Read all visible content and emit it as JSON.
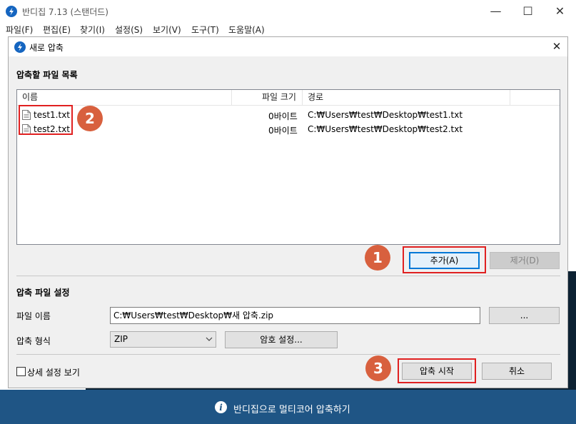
{
  "app": {
    "title": "반디집 7.13 (스탠더드)",
    "window_controls": [
      "—",
      "☐",
      "✕"
    ]
  },
  "menu": [
    "파일(F)",
    "편집(E)",
    "찾기(I)",
    "설정(S)",
    "보기(V)",
    "도구(T)",
    "도움말(A)"
  ],
  "dialog": {
    "title": "새로 압축",
    "close": "✕",
    "file_list_section": "압축할 파일 목록",
    "columns": {
      "name": "이름",
      "size": "파일 크기",
      "path": "경로"
    },
    "files": [
      {
        "name": "test1.txt",
        "size": "0바이트",
        "path": "C:₩Users₩test₩Desktop₩test1.txt"
      },
      {
        "name": "test2.txt",
        "size": "0바이트",
        "path": "C:₩Users₩test₩Desktop₩test2.txt"
      }
    ],
    "add_button": "추가(A)",
    "remove_button": "제거(D)",
    "settings_section": "압축 파일 설정",
    "filename_label": "파일 이름",
    "filename_value": "C:₩Users₩test₩Desktop₩새 압축.zip",
    "browse_button": "...",
    "format_label": "압축 형식",
    "format_value": "ZIP",
    "password_button": "암호 설정...",
    "details_checkbox": "상세 설정 보기",
    "start_button": "압축 시작",
    "cancel_button": "취소"
  },
  "annotations": [
    "1",
    "2",
    "3"
  ],
  "bottom_bar": {
    "text": "반디집으로 멀티코어 압축하기"
  },
  "colors": {
    "accent": "#0078d7",
    "annotation_red": "#e02020",
    "badge": "#d8603e",
    "bottom_bar": "#1f5585"
  }
}
